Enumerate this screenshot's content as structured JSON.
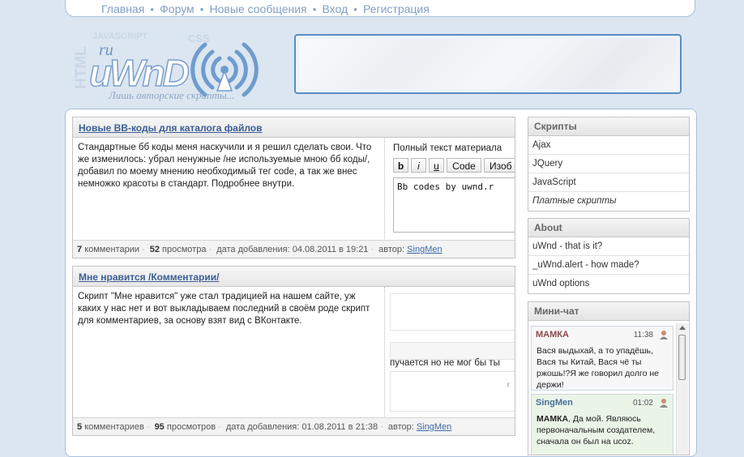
{
  "nav": {
    "items": [
      "Главная",
      "Форум",
      "Новые сообщения",
      "Вход",
      "Регистрация"
    ]
  },
  "logo": {
    "tags": [
      "HTML",
      "JAVASCRIPT",
      "CSS"
    ],
    "prefix": "ru",
    "name": "uWnD",
    "slogan": "Лишь авторские скрипты..."
  },
  "posts": [
    {
      "title": "Новые BB-коды для каталога файлов",
      "text": "Стандартные бб коды меня наскучили и я решил сделать свои. Что же изменилось: убрал ненужные /не используемые мною бб коды/, добавил по моему мнению необходимый тег code, а так же внес немножко красоты в стандарт. Подробнее внутри.",
      "editor": {
        "title": "Полный текст материала",
        "buttons": [
          "b",
          "i",
          "u",
          "Code",
          "Изоб"
        ],
        "content": "Bb codes by uwnd.r"
      },
      "comments_count": "7",
      "comments_label": "комментарии",
      "views_count": "52",
      "views_label": "просмотра",
      "date_label": "дата добавления:",
      "date": "04.08.2011 в 19:21",
      "author_label": "автор:",
      "author": "SingMen"
    },
    {
      "title": "Мне нравится /Комментарии/",
      "text": "Скрипт \"Мне нравится\" уже стал традицией на нашем сайте, уж каких у нас нет и вот выкладываем последний в своём роде скрипт для комментариев, за основу взят вид с ВКонтакте.",
      "widget": {
        "text": "пучается но не мог бы ты",
        "corner": "r"
      },
      "comments_count": "5",
      "comments_label": "комментариев",
      "views_count": "95",
      "views_label": "просмотров",
      "date_label": "дата добавления:",
      "date": "01.08.2011 в 21:38",
      "author_label": "автор:",
      "author": "SingMen"
    }
  ],
  "sidebar": {
    "scripts": {
      "title": "Скрипты",
      "items": [
        "Ajax",
        "JQuery",
        "JavaScript",
        "Платные скрипты"
      ]
    },
    "about": {
      "title": "About",
      "items": [
        "uWnd - that is it?",
        "_uWnd.alert - how made?",
        "uWnd options"
      ]
    },
    "chat": {
      "title": "Мини-чат",
      "messages": [
        {
          "user": "МАМКА",
          "time": "11:38",
          "text": "Вася выдыхай, а то упадёшь, Вася ты Китай, Вася чё ты ржошь!?Я же говорил долго не держи!"
        },
        {
          "user": "SingMen",
          "time": "01:02",
          "bold_prefix": "МАМКА",
          "text": ", Да мой. Являюсь первоначальным создателем, сначала он был на ucoz."
        }
      ]
    }
  },
  "colors": {
    "page_bg": "#dbe6f1",
    "link": "#3b5f96",
    "nav_link": "#7f9fc5",
    "banner_border": "#5a8bc4"
  }
}
